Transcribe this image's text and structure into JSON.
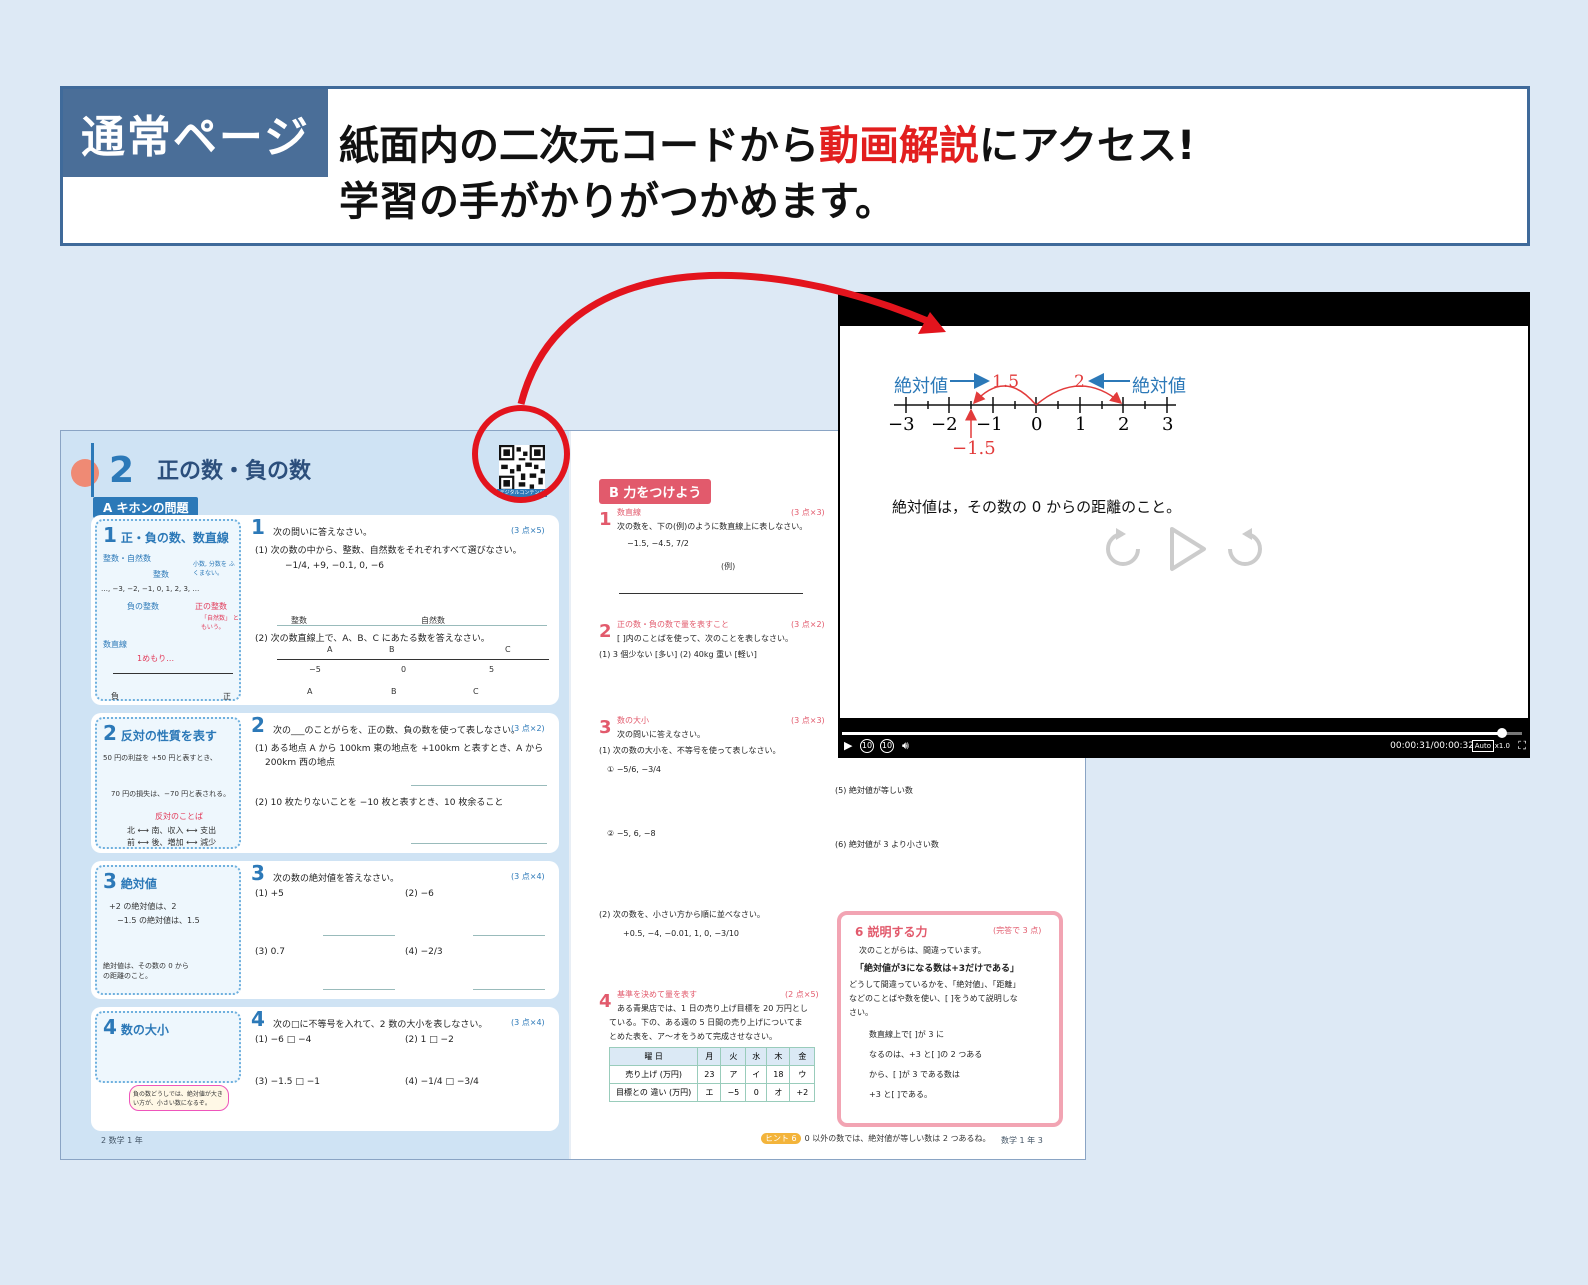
{
  "banner": {
    "tag": "通常ページ",
    "line1_pre": "紙面内の二次元コードから",
    "line1_highlight": "動画解説",
    "line1_post": "にアクセス!",
    "line2": "学習の手がかりがつかめます。"
  },
  "book": {
    "unit_number": "2",
    "unit_title": "正の数・負の数",
    "qr_label": "デジタルコンテンツ",
    "kihon_label": "A キホンの問題",
    "sections": [
      {
        "num": "1",
        "title": "正・負の数、数直線"
      },
      {
        "num": "2",
        "title": "反対の性質を表す"
      },
      {
        "num": "3",
        "title": "絶対値"
      },
      {
        "num": "4",
        "title": "数の大小"
      }
    ],
    "side1": {
      "sub1": "整数・自然数",
      "seq": "…, −3, −2, −1, 0, 1, 2, 3, …",
      "neg": "負の整数",
      "pos": "正の整数",
      "int_label": "整数",
      "note1": "小数, 分数を ふくまない。",
      "note2": "「自然数」 ともいう。",
      "sub2": "数直線",
      "unit": "1めもり…",
      "neg_label": "負",
      "pos_label": "正"
    },
    "q1": {
      "intro": "次の問いに答えなさい。",
      "points": "(3 点×5)",
      "p1": "(1)  次の数の中から、整数、自然数をそれぞれすべて選びなさい。",
      "nums": "−1/4, +9, −0.1, 0, −6",
      "int_head": "整数",
      "nat_head": "自然数",
      "p2": "(2)  次の数直線上で、A、B、C にあたる数を答えなさい。",
      "labels": [
        "A",
        "B",
        "C"
      ],
      "ticks": [
        "−5",
        "0",
        "5"
      ]
    },
    "q2": {
      "intro": "次の___のことがらを、正の数、負の数を使って表しなさい。",
      "points": "(3 点×2)",
      "p1": "(1)  ある地点 A から 100km 東の地点を +100km と表すとき、A から",
      "p1b": "200km 西の地点",
      "p2": "(2)  10 枚たりないことを −10 枚と表すとき、10 枚余ること",
      "side_ex": "50 円の利益を +50 円と表すとき、",
      "side_ex2": "70 円の損失は、−70 円と表される。",
      "side_words": "反対のことば",
      "side_words2": "北 ⟷ 南、収入 ⟷ 支出",
      "side_words3": "前 ⟷ 後、増加 ⟷ 減少"
    },
    "q3": {
      "intro": "次の数の絶対値を答えなさい。",
      "points": "(3 点×4)",
      "items": [
        "(1)  +5",
        "(2)  −6",
        "(3)  0.7",
        "(4)  −2/3"
      ],
      "side_ex": "+2 の絶対値は、2",
      "side_ex2": "−1.5 の絶対値は、1.5",
      "side_def": "絶対値は、その数の 0 からの距離のこと。"
    },
    "q4": {
      "intro": "次の□に不等号を入れて、2 数の大小を表しなさい。",
      "points": "(3 点×4)",
      "items": [
        "(1)  −6 □ −4",
        "(2)  1 □ −2",
        "(3)  −1.5 □ −1",
        "(4)  −1/4 □ −3/4"
      ],
      "side_note": "負の数どうしでは、絶対値が大きい方が、小さい数になるぞ。"
    },
    "left_footer": "2  数学 1 年",
    "right": {
      "banner": "B 力をつけよう",
      "r1_head": "数直線",
      "r1_points": "(3 点×3)",
      "r1_text": "次の数を、下の(例)のように数直線上に表しなさい。",
      "r1_nums": "−1.5, −4.5, 7/2",
      "r1_ex": "(例)",
      "r2_head": "正の数・負の数で量を表すこと",
      "r2_points": "(3 点×2)",
      "r2_text": "[ ]内のことばを使って、次のことを表しなさい。",
      "r2_items": "(1)  3 個少ない [多い]      (2)  40kg 重い [軽い]",
      "r3_head": "数の大小",
      "r3_points": "(3 点×3)",
      "r3_text": "次の問いに答えなさい。",
      "r3_p1": "(1)  次の数の大小を、不等号を使って表しなさい。",
      "r3_i1": "①  −5/6, −3/4",
      "r3_i2": "②  −5, 6, −8",
      "r3_p2": "(2)  次の数を、小さい方から順に並べなさい。",
      "r3_nums": "+0.5, −4, −0.01, 1, 0, −3/10",
      "r4_head": "基準を決めて量を表す",
      "r4_points": "(2 点×5)",
      "r4_text": "ある青果店では、1 日の売り上げ目標を 20 万円とし",
      "r4_text2": "ている。下の、ある週の 5 日間の売り上げについてま",
      "r4_text3": "とめた表を、ア〜オをうめて完成させなさい。",
      "table_head": [
        "曜 日",
        "月",
        "火",
        "水",
        "木",
        "金"
      ],
      "table_row1": [
        "売り上げ (万円)",
        "23",
        "ア",
        "イ",
        "18",
        "ウ"
      ],
      "table_row2": [
        "目標との 違い (万円)",
        "エ",
        "−5",
        "0",
        "オ",
        "+2"
      ],
      "r5": "(5)  絶対値が等しい数",
      "r6": "(6)  絶対値が 3 より小さい数",
      "box6_title": "6 説明する力",
      "box6_points": "(完答で 3 点)",
      "box6_text1": "次のことがらは、間違っています。",
      "box6_quote": "「絶対値が3になる数は+3だけである」",
      "box6_text2": "どうして間違っているかを、「絶対値」、「距離」",
      "box6_text3": "などのことばや数を使い、[ ]をうめて説明しな",
      "box6_text4": "さい。",
      "box6_fill1": "数直線上で[        ]が 3 に",
      "box6_fill2": "なるのは、+3 と[      ]の 2 つある",
      "box6_fill3": "から、[          ]が 3 である数は",
      "box6_fill4": "+3 と[      ]である。",
      "hint": "0 以外の数では、絶対値が等しい数は 2 つあるね。",
      "hint_tag": "ヒント 6",
      "footer": "数学 1 年  3"
    }
  },
  "player": {
    "label_left": "絶対値",
    "val_left": "1.5",
    "val_right": "2",
    "label_right": "絶対値",
    "ticks": [
      "−3",
      "−2",
      "−1",
      "0",
      "1",
      "2",
      "3"
    ],
    "marker": "−1.5",
    "caption": "絶対値は，その数の 0 からの距離のこと。",
    "time": "00:00:31/00:00:32",
    "progress": 0.97,
    "quality": "Auto",
    "speed": "x1.0",
    "skip_back": "10",
    "skip_fwd": "10"
  }
}
